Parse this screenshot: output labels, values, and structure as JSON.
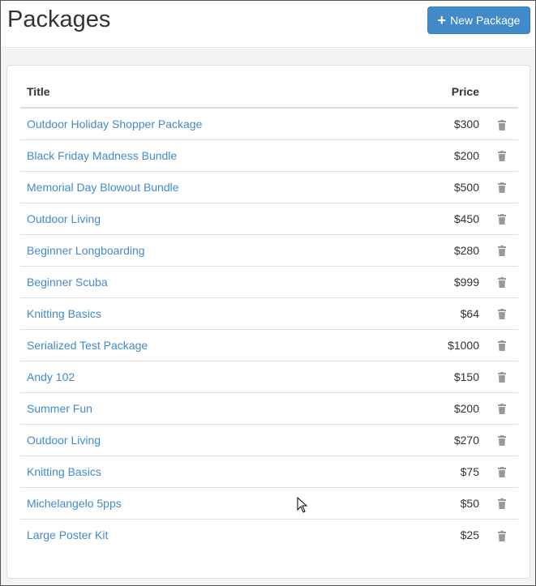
{
  "header": {
    "title": "Packages",
    "new_button_label": "New Package"
  },
  "table": {
    "columns": {
      "title": "Title",
      "price": "Price"
    },
    "rows": [
      {
        "title": "Outdoor Holiday Shopper Package",
        "price": "$300"
      },
      {
        "title": "Black Friday Madness Bundle",
        "price": "$200"
      },
      {
        "title": "Memorial Day Blowout Bundle",
        "price": "$500"
      },
      {
        "title": "Outdoor Living",
        "price": "$450"
      },
      {
        "title": "Beginner Longboarding",
        "price": "$280"
      },
      {
        "title": "Beginner Scuba",
        "price": "$999"
      },
      {
        "title": "Knitting Basics",
        "price": "$64"
      },
      {
        "title": "Serialized Test Package",
        "price": "$1000"
      },
      {
        "title": "Andy 102",
        "price": "$150"
      },
      {
        "title": "Summer Fun",
        "price": "$200"
      },
      {
        "title": "Outdoor Living",
        "price": "$270"
      },
      {
        "title": "Knitting Basics",
        "price": "$75"
      },
      {
        "title": "Michelangelo 5pps",
        "price": "$50"
      },
      {
        "title": "Large Poster Kit",
        "price": "$25"
      }
    ]
  },
  "colors": {
    "primary": "#428bca",
    "link": "#428bca",
    "icon_gray": "#999999"
  },
  "icons": {
    "new": "plus-icon",
    "delete": "trash-icon"
  }
}
